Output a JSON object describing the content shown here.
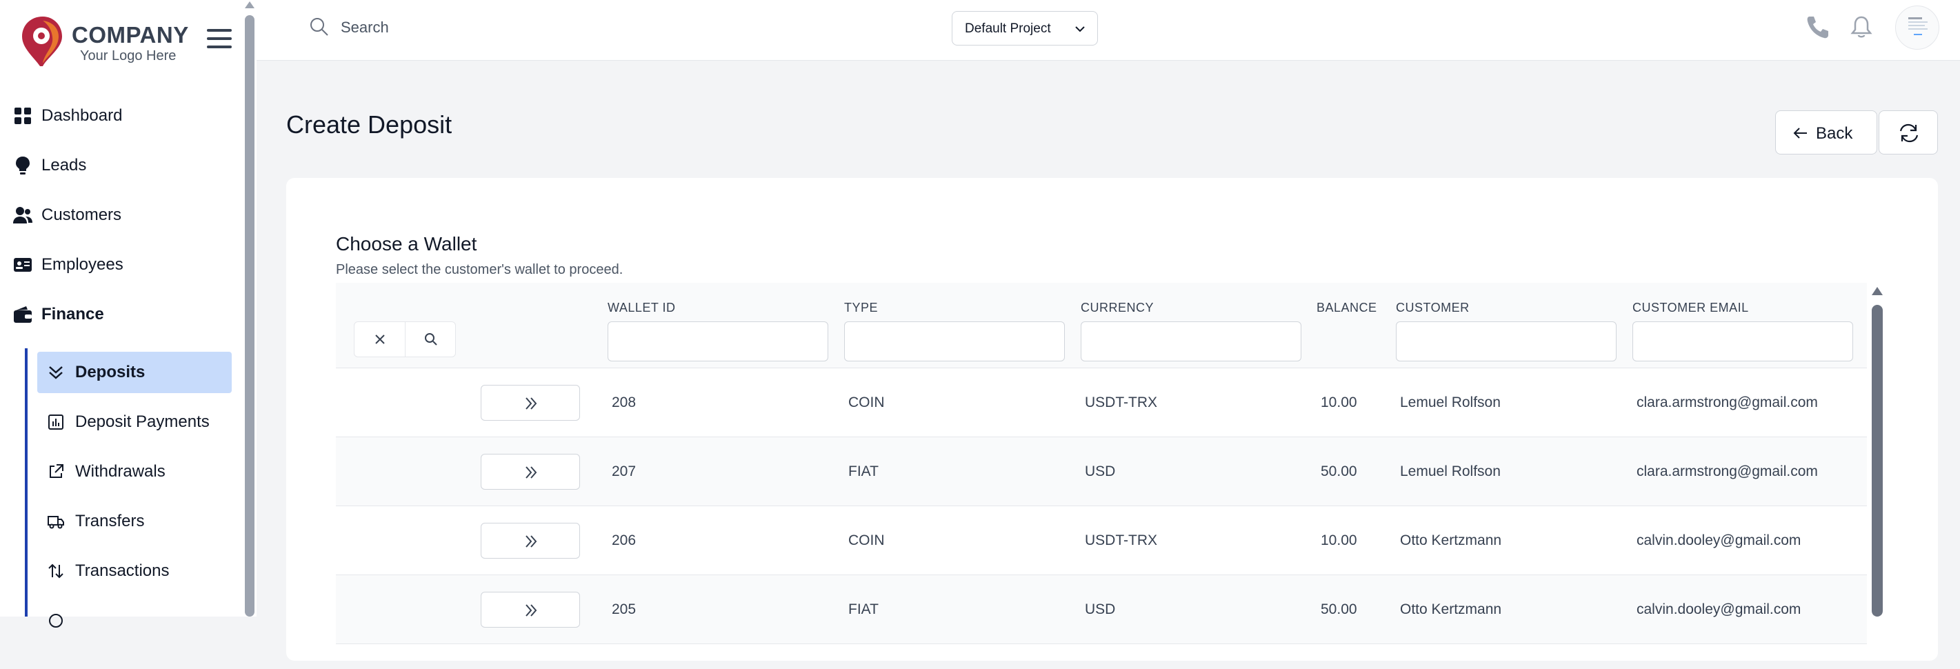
{
  "brand": {
    "name": "COMPANY",
    "tagline": "Your Logo Here",
    "colors": {
      "primary": "#b5263f",
      "secondary": "#e8762d"
    }
  },
  "sidebar": {
    "items": [
      {
        "label": "Dashboard",
        "icon": "grid-icon"
      },
      {
        "label": "Leads",
        "icon": "lightbulb-icon"
      },
      {
        "label": "Customers",
        "icon": "users-icon"
      },
      {
        "label": "Employees",
        "icon": "id-card-icon"
      },
      {
        "label": "Finance",
        "icon": "wallet-icon"
      }
    ],
    "finance_sub": [
      {
        "label": "Deposits",
        "icon": "double-chevron-down-icon",
        "active": true
      },
      {
        "label": "Deposit Payments",
        "icon": "chart-box-icon"
      },
      {
        "label": "Withdrawals",
        "icon": "external-link-icon"
      },
      {
        "label": "Transfers",
        "icon": "truck-icon"
      },
      {
        "label": "Transactions",
        "icon": "arrows-up-down-icon"
      }
    ]
  },
  "header": {
    "search_placeholder": "Search",
    "project": "Default Project"
  },
  "page": {
    "title": "Create Deposit",
    "back_label": "Back"
  },
  "card": {
    "title": "Choose a Wallet",
    "subtitle": "Please select the customer's wallet to proceed."
  },
  "table": {
    "columns": [
      "WALLET ID",
      "TYPE",
      "CURRENCY",
      "BALANCE",
      "CUSTOMER",
      "CUSTOMER EMAIL"
    ],
    "rows": [
      {
        "wallet_id": "208",
        "type": "COIN",
        "currency": "USDT-TRX",
        "balance": "10.00",
        "customer": "Lemuel Rolfson",
        "email": "clara.armstrong@gmail.com"
      },
      {
        "wallet_id": "207",
        "type": "FIAT",
        "currency": "USD",
        "balance": "50.00",
        "customer": "Lemuel Rolfson",
        "email": "clara.armstrong@gmail.com"
      },
      {
        "wallet_id": "206",
        "type": "COIN",
        "currency": "USDT-TRX",
        "balance": "10.00",
        "customer": "Otto Kertzmann",
        "email": "calvin.dooley@gmail.com"
      },
      {
        "wallet_id": "205",
        "type": "FIAT",
        "currency": "USD",
        "balance": "50.00",
        "customer": "Otto Kertzmann",
        "email": "calvin.dooley@gmail.com"
      }
    ]
  }
}
